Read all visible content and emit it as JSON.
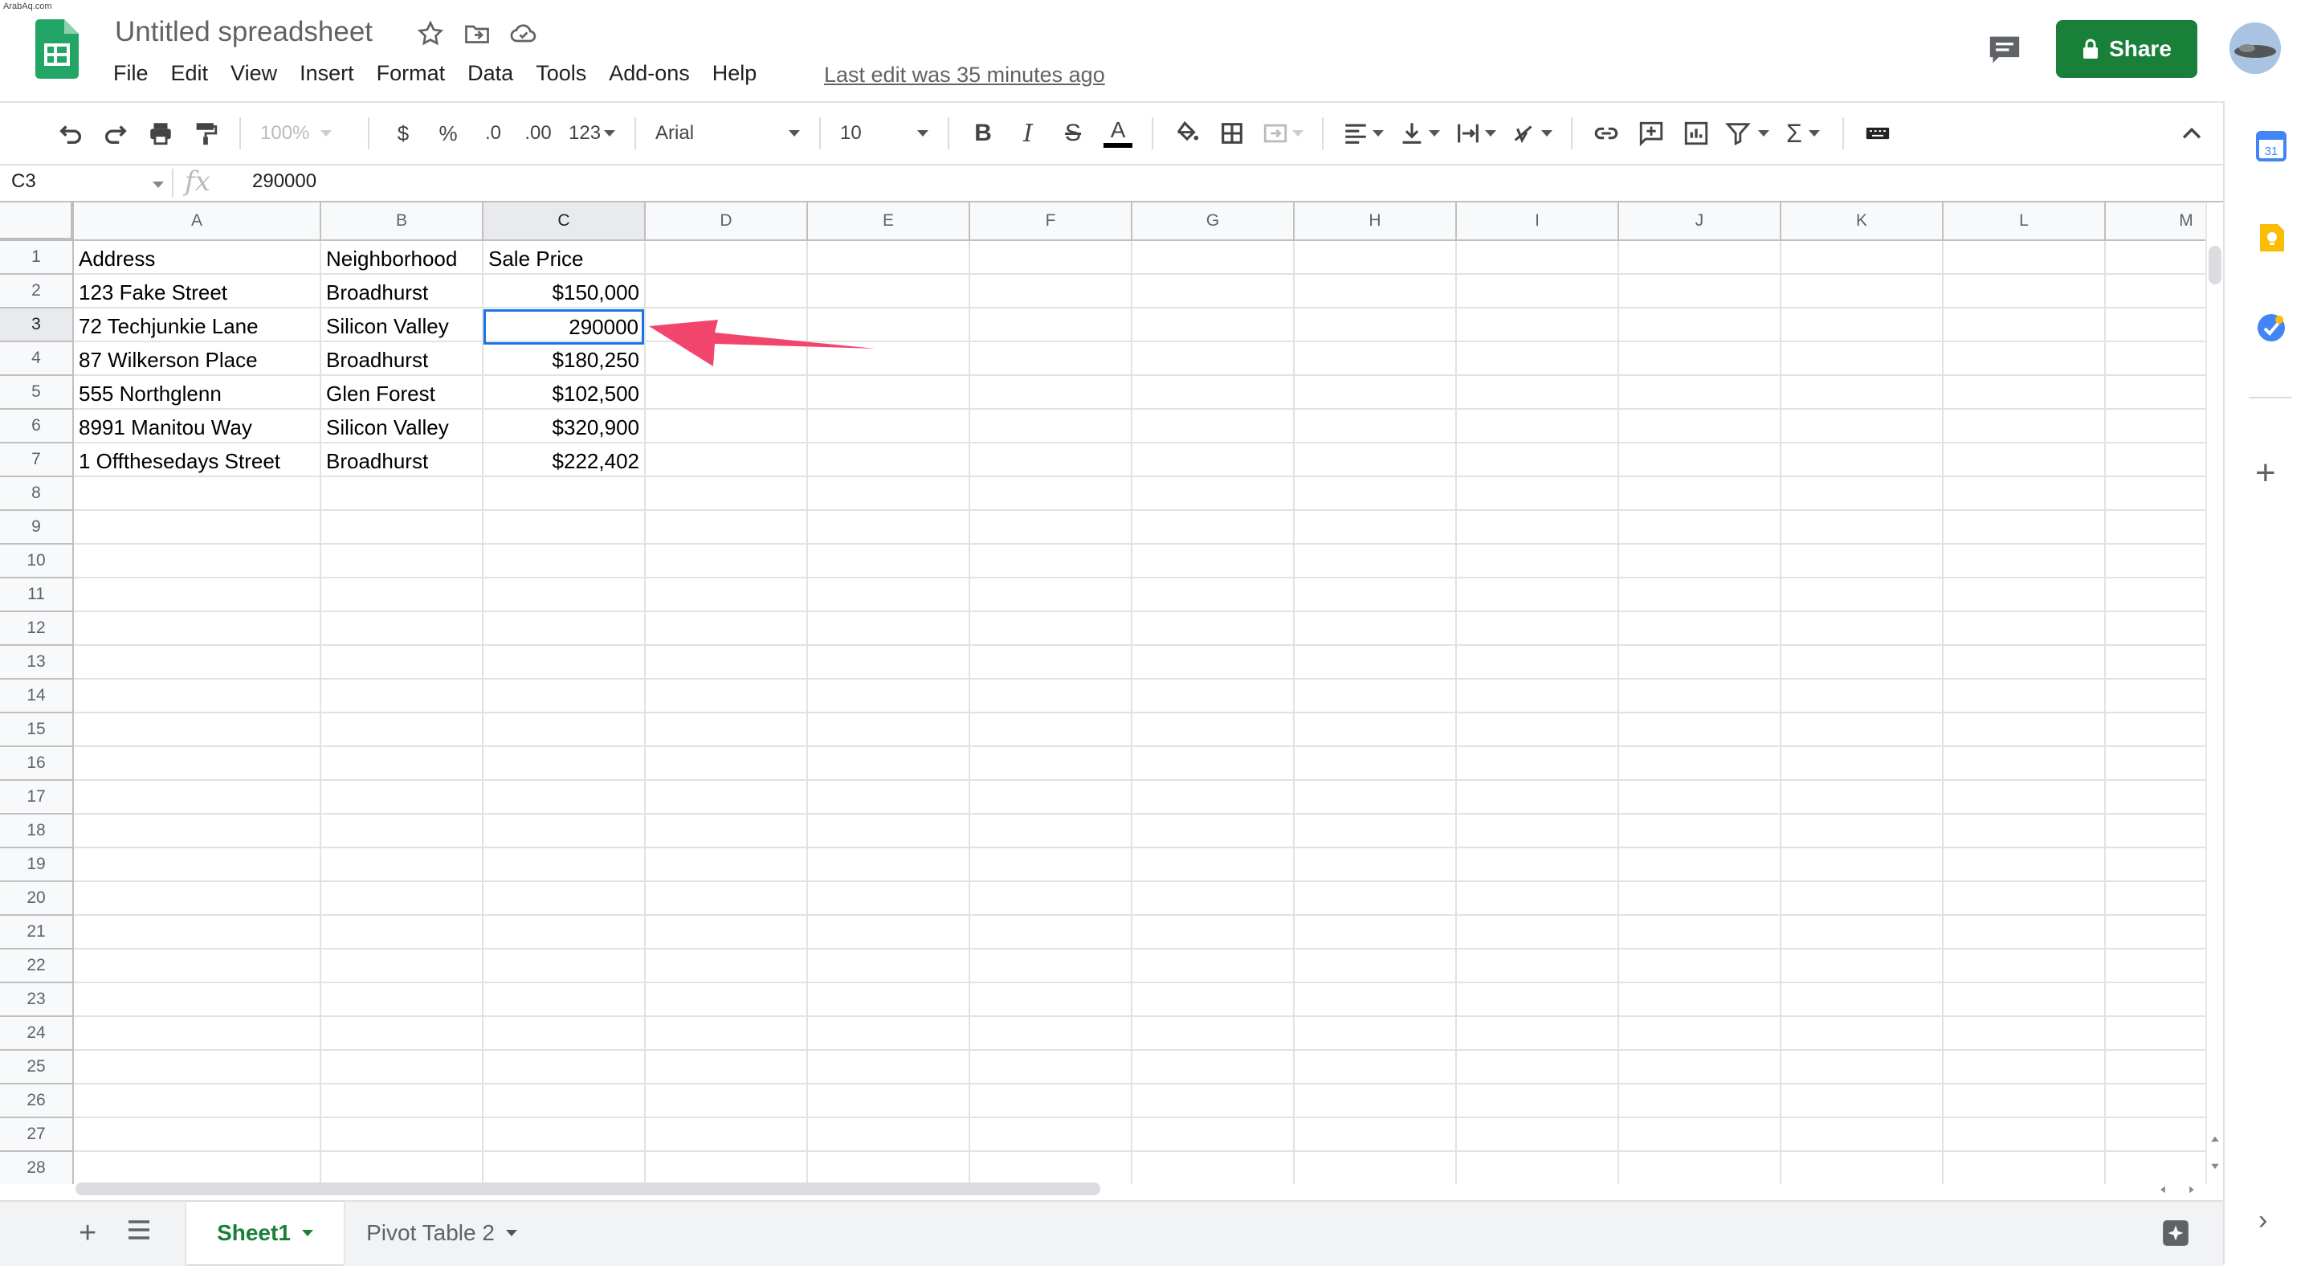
{
  "watermark": "ArabAq.com",
  "header": {
    "title": "Untitled spreadsheet",
    "menu": [
      "File",
      "Edit",
      "View",
      "Insert",
      "Format",
      "Data",
      "Tools",
      "Add-ons",
      "Help"
    ],
    "last_edit": "Last edit was 35 minutes ago",
    "share_label": "Share"
  },
  "toolbar": {
    "zoom": "100%",
    "currency": "$",
    "percent": "%",
    "decrease_decimals": ".0",
    "increase_decimals": ".00",
    "more_formats": "123",
    "font": "Arial",
    "font_size": "10",
    "bold": "B",
    "italic": "I",
    "strike": "S",
    "text_color": "A",
    "sum": "Σ"
  },
  "formula_bar": {
    "name_box": "C3",
    "fx": "fx",
    "value": "290000"
  },
  "sheet": {
    "columns": [
      "A",
      "B",
      "C",
      "D",
      "E",
      "F",
      "G",
      "H",
      "I",
      "J",
      "K",
      "L",
      "M"
    ],
    "rows": [
      "1",
      "2",
      "3",
      "4",
      "5",
      "6",
      "7",
      "8",
      "9",
      "10",
      "11",
      "12",
      "13",
      "14",
      "15",
      "16",
      "17",
      "18",
      "19",
      "20",
      "21",
      "22",
      "23",
      "24",
      "25",
      "26",
      "27",
      "28"
    ],
    "cells": {
      "r1": [
        "Address",
        "Neighborhood",
        "Sale Price"
      ],
      "r2": [
        "123 Fake Street",
        "Broadhurst",
        "$150,000"
      ],
      "r3": [
        "72 Techjunkie Lane",
        "Silicon Valley",
        "290000"
      ],
      "r4": [
        "87 Wilkerson Place",
        "Broadhurst",
        "$180,250"
      ],
      "r5": [
        "555 Northglenn",
        "Glen Forest",
        "$102,500"
      ],
      "r6": [
        "8991 Manitou Way",
        "Silicon Valley",
        "$320,900"
      ],
      "r7": [
        "1 Offthesedays Street",
        "Broadhurst",
        "$222,402"
      ]
    },
    "active_cell": "C3"
  },
  "tabs": {
    "sheet1": "Sheet1",
    "sheet2": "Pivot Table 2"
  },
  "side_panel": {
    "calendar_day": "31",
    "plus": "+",
    "collapse": "›"
  },
  "colors": {
    "brand_green": "#188038",
    "selection_blue": "#1a73e8",
    "arrow_pink": "#f2456c"
  }
}
